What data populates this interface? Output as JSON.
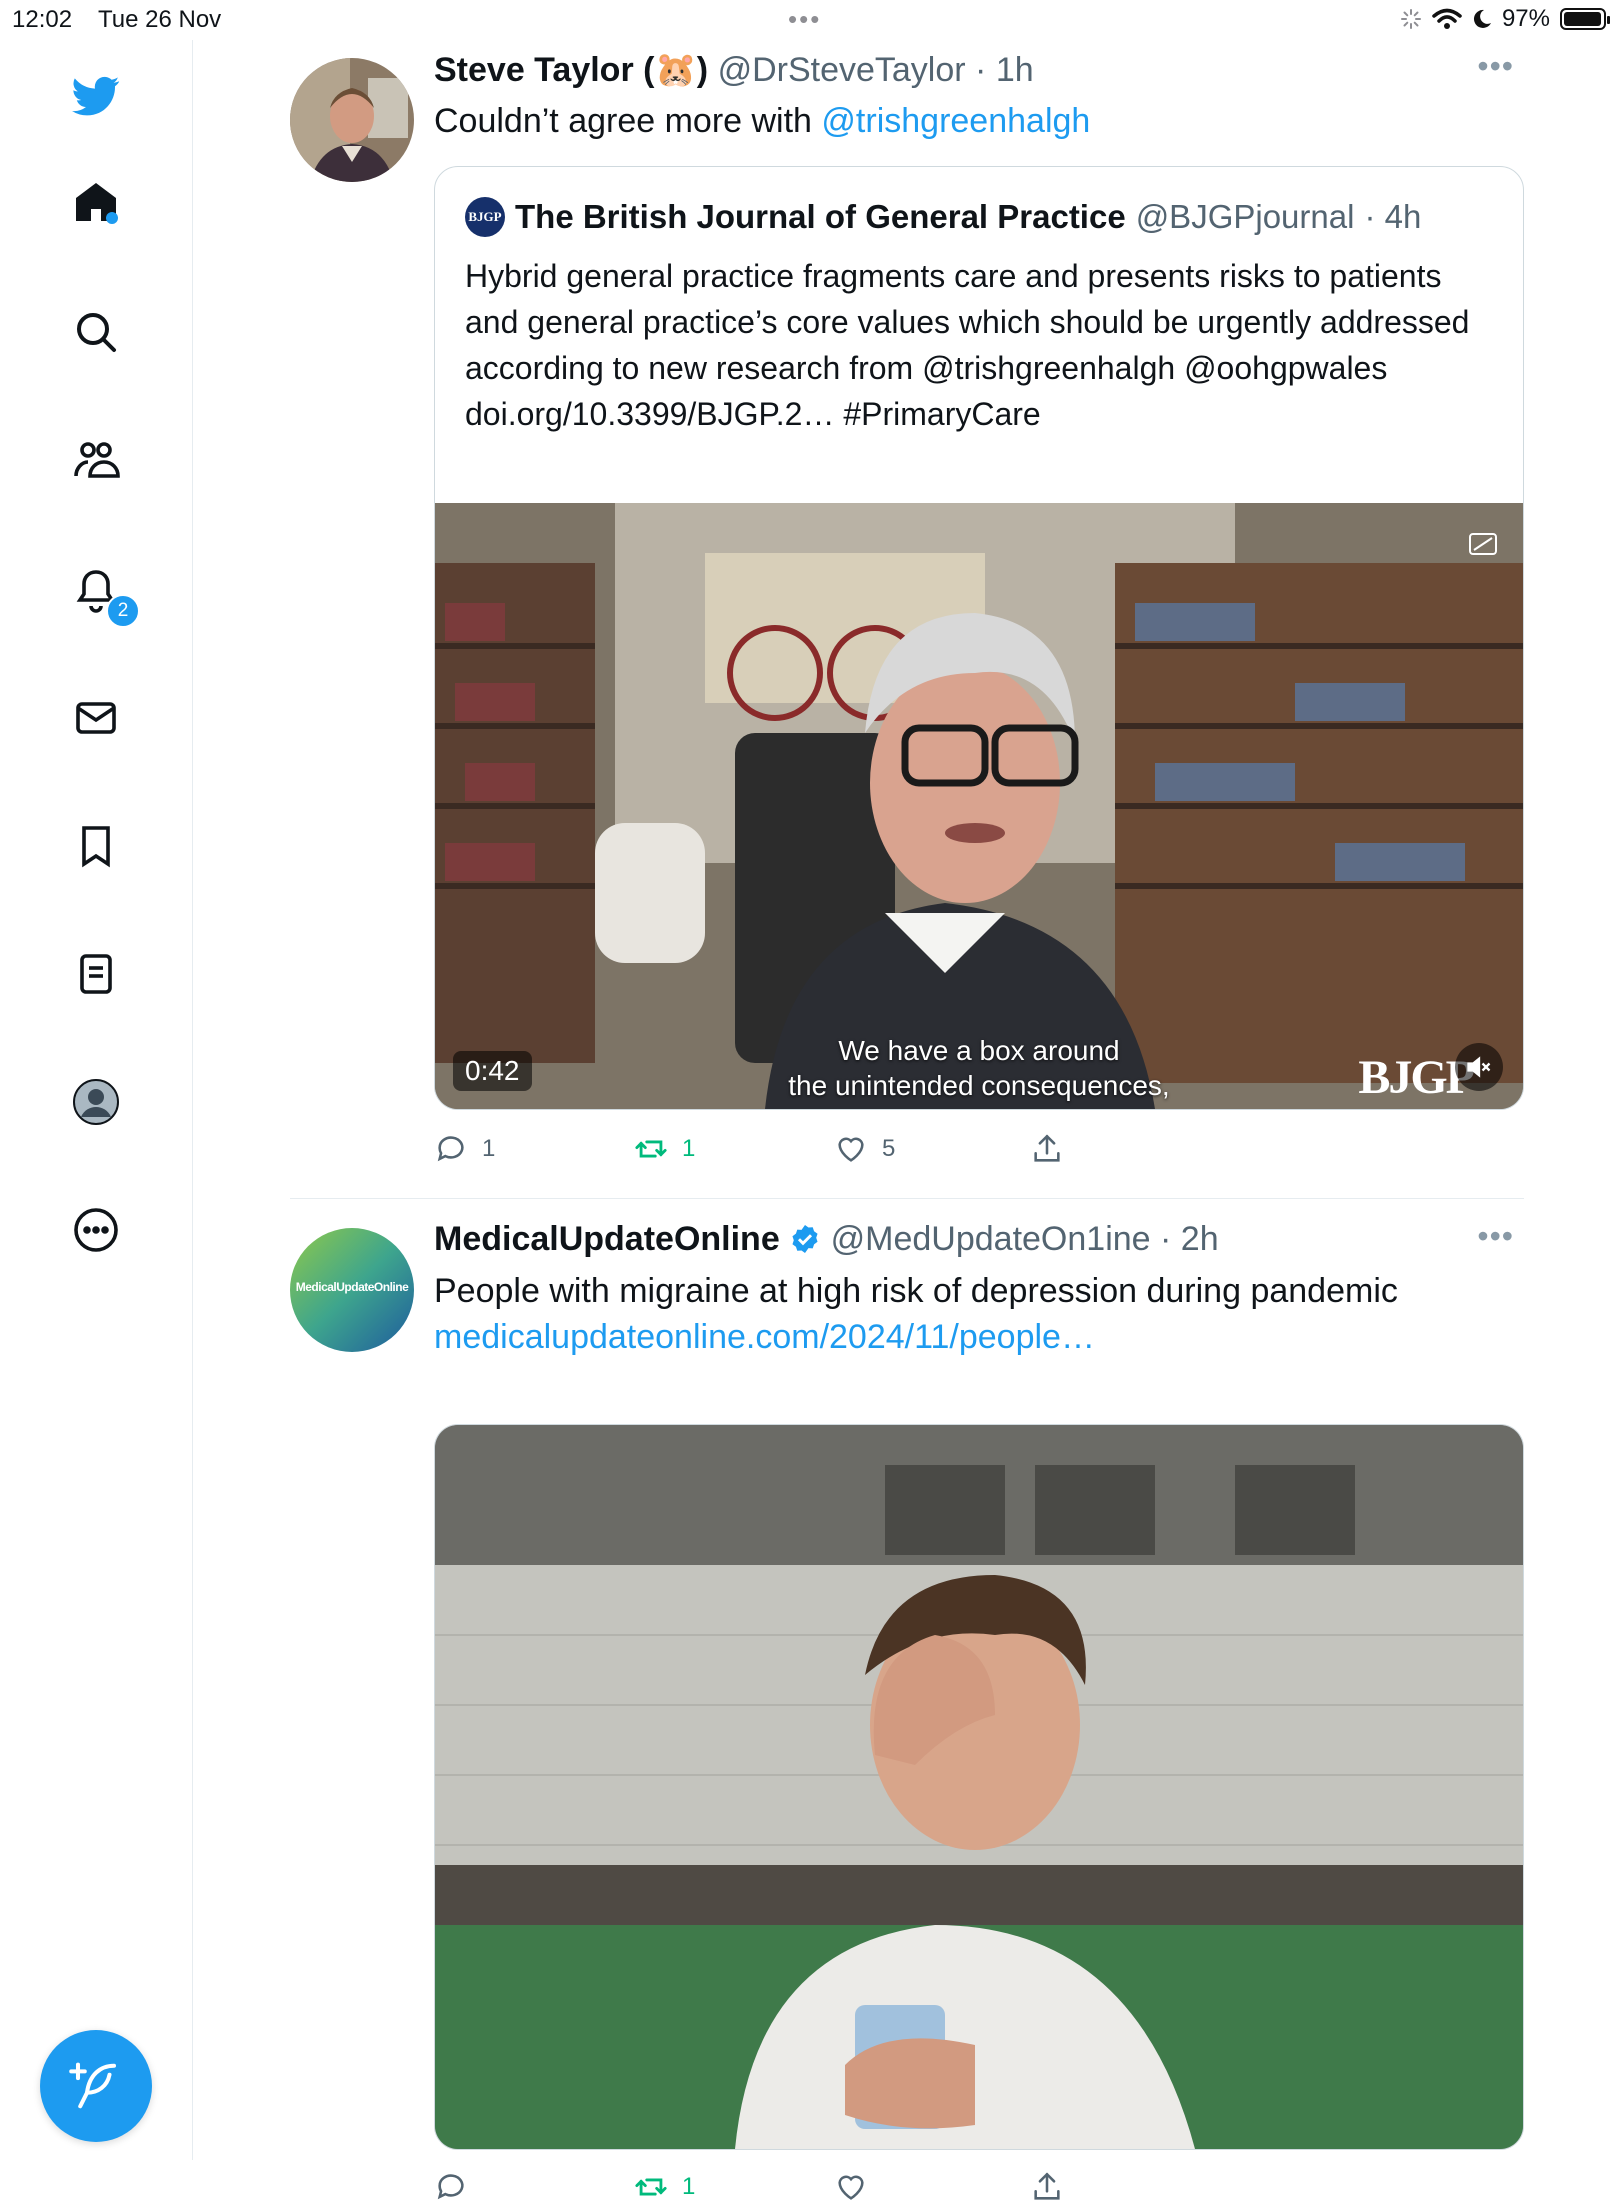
{
  "status_bar": {
    "time": "12:02",
    "date": "Tue 26 Nov",
    "battery": "97%",
    "battery_level": 0.97
  },
  "sidebar": {
    "items": [
      {
        "label": "Home",
        "icon": "home-icon"
      },
      {
        "label": "Search",
        "icon": "search-icon"
      },
      {
        "label": "Communities",
        "icon": "communities-icon"
      },
      {
        "label": "Notifications",
        "icon": "bell-icon",
        "badge": "2"
      },
      {
        "label": "Messages",
        "icon": "envelope-icon"
      },
      {
        "label": "Bookmarks",
        "icon": "bookmark-icon"
      },
      {
        "label": "Lists",
        "icon": "list-icon"
      },
      {
        "label": "Profile",
        "icon": "profile-icon"
      },
      {
        "label": "More",
        "icon": "more-circle-icon"
      }
    ],
    "notification_badge": "2",
    "compose_icon": "compose-icon"
  },
  "tweets": [
    {
      "name": "Steve Taylor (🐹)",
      "handle": "@DrSteveTaylor",
      "time": "· 1h",
      "text": "Couldn’t agree more with ",
      "mention": "@trishgreenhalgh",
      "quote": {
        "logo_text": "BJGP",
        "name": "The British Journal of General Practice",
        "handle": "@BJGPjournal",
        "time": "· 4h",
        "text": "Hybrid general practice fragments care and presents risks to patients and general practice’s core values which should be urgently addressed according to new research from @trishgreenhalgh @oohgpwales doi.org/10.3399/BJGP.2… #PrimaryCare",
        "video": {
          "duration": "0:42",
          "caption_line1": "We have a box around",
          "caption_line2": "the unintended consequences,",
          "brand": "BJGP"
        }
      },
      "actions": {
        "replies": "1",
        "retweets": "1",
        "likes": "5"
      }
    },
    {
      "name": "MedicalUpdateOnline",
      "handle": "@MedUpdateOn1ine",
      "time": "· 2h",
      "avatar_text": "MedicalUpdateOnline",
      "text": "People with migraine at high risk of depression during pandemic",
      "link": "medicalupdateonline.com/2024/11/people…",
      "actions": {
        "retweets": "1"
      }
    }
  ]
}
